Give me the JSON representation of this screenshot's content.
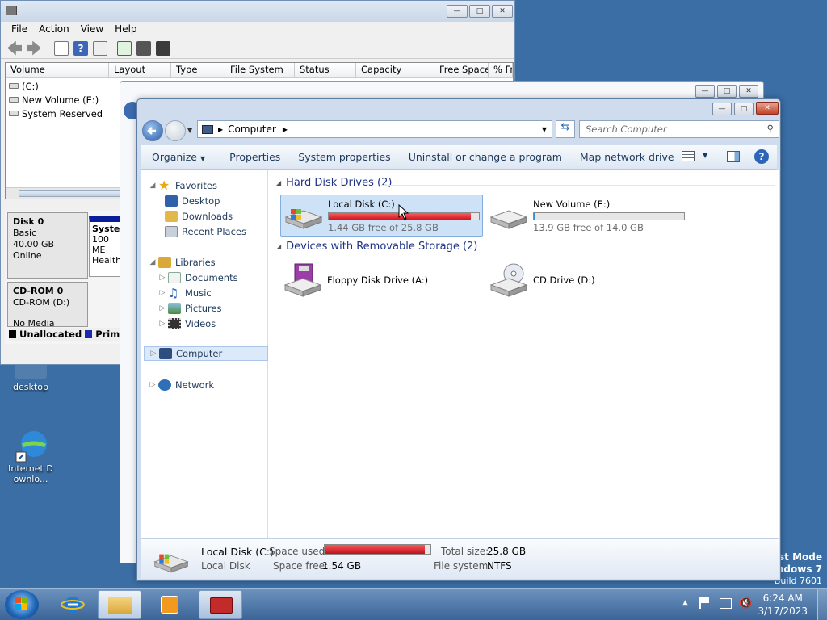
{
  "desktop": {
    "icons": [
      {
        "label": "desktop"
      },
      {
        "label": "Internet Downlo..."
      }
    ],
    "watermark": {
      "line1": "est Mode",
      "line2": "indows 7",
      "line3": "Build 7601"
    }
  },
  "disk_mgmt": {
    "menu": [
      "File",
      "Action",
      "View",
      "Help"
    ],
    "columns": [
      "Volume",
      "Layout",
      "Type",
      "File System",
      "Status",
      "Capacity",
      "Free Space",
      "% Fr"
    ],
    "volumes": [
      {
        "name": "(C:)",
        "layout": "S"
      },
      {
        "name": "New Volume (E:)",
        "layout": "S"
      },
      {
        "name": "System Reserved",
        "layout": "S"
      }
    ],
    "disk0": {
      "name": "Disk 0",
      "type": "Basic",
      "size": "40.00 GB",
      "status": "Online"
    },
    "partition": {
      "name": "Syste",
      "size": "100 ME",
      "status": "Healthy"
    },
    "cdrom": {
      "name": "CD-ROM 0",
      "type": "CD-ROM (D:)",
      "media": "No Media"
    },
    "legend": {
      "unallocated": "Unallocated",
      "primary": "Prima"
    }
  },
  "explorer": {
    "address": {
      "root": "Computer"
    },
    "search_placeholder": "Search Computer",
    "commands": [
      "Organize",
      "Properties",
      "System properties",
      "Uninstall or change a program",
      "Map network drive",
      "»"
    ],
    "nav": {
      "favorites": "Favorites",
      "desktop": "Desktop",
      "downloads": "Downloads",
      "recent": "Recent Places",
      "libraries": "Libraries",
      "documents": "Documents",
      "music": "Music",
      "pictures": "Pictures",
      "videos": "Videos",
      "computer": "Computer",
      "network": "Network"
    },
    "groups": {
      "hdd": "Hard Disk Drives (2)",
      "removable": "Devices with Removable Storage (2)"
    },
    "drives": [
      {
        "name": "Local Disk (C:)",
        "free": "1.44 GB free of 25.8 GB",
        "used_fraction": 0.944,
        "bar_color": "#d6141b"
      },
      {
        "name": "New Volume (E:)",
        "free": "13.9 GB free of 14.0 GB",
        "used_fraction": 0.007,
        "bar_color": "#2f8fd8"
      }
    ],
    "devices": [
      {
        "name": "Floppy Disk Drive (A:)"
      },
      {
        "name": "CD Drive (D:)"
      }
    ],
    "details": {
      "name": "Local Disk (C:)",
      "kind": "Local Disk",
      "space_used_label": "Space used:",
      "space_free_label": "Space free:",
      "space_free": "1.54 GB",
      "total_label": "Total size:",
      "total": "25.8 GB",
      "fs_label": "File system:",
      "fs": "NTFS",
      "used_fraction": 0.944
    }
  },
  "taskbar": {
    "time": "6:24 AM",
    "date": "3/17/2023"
  }
}
